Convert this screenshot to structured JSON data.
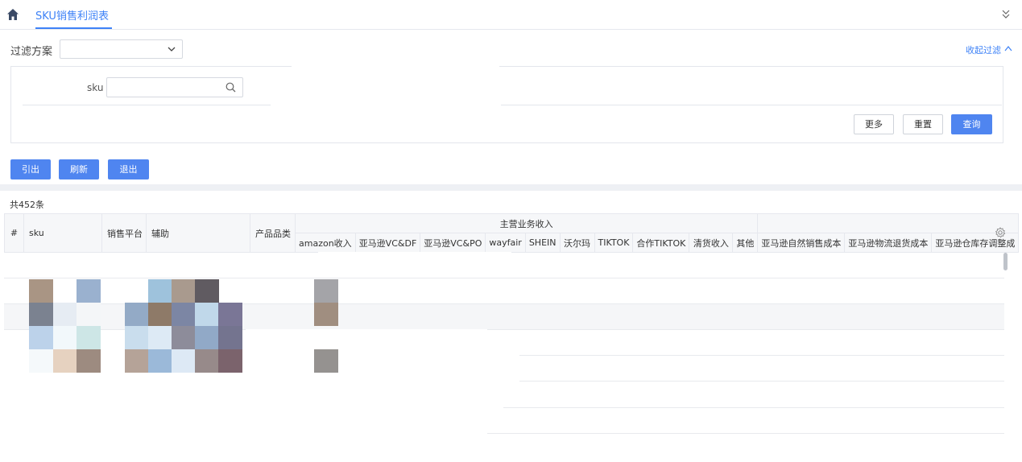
{
  "tab": {
    "label": "SKU销售利润表"
  },
  "filter": {
    "scheme_label": "过滤方案",
    "scheme_value": "",
    "collapse_label": "收起过滤",
    "sku_label": "sku",
    "sku_placeholder": "",
    "more_label": "更多",
    "reset_label": "重置",
    "query_label": "查询"
  },
  "actions": {
    "export_label": "引出",
    "refresh_label": "刷新",
    "exit_label": "退出"
  },
  "table": {
    "total": "共452条",
    "columns": {
      "index": "#",
      "sku": "sku",
      "platform": "销售平台",
      "aux": "辅助",
      "category": "产品品类",
      "group_main": "主营业务收入",
      "amazon": "amazon收入",
      "vcdf": "亚马逊VC&DF",
      "vcpo": "亚马逊VC&PO",
      "wayfair": "wayfair",
      "shein": "SHEIN",
      "walmart": "沃尔玛",
      "tiktok": "TIKTOK",
      "coop_tiktok": "合作TIKTOK",
      "clearance": "清货收入",
      "other": "其他",
      "natural_cost": "亚马逊自然销售成本",
      "return_cost": "亚马逊物流退货成本",
      "inventory_adj": "亚马逊仓库存调整成"
    }
  },
  "colors": {
    "accent": "#3e82f7",
    "primary_button": "#4f85f0"
  }
}
